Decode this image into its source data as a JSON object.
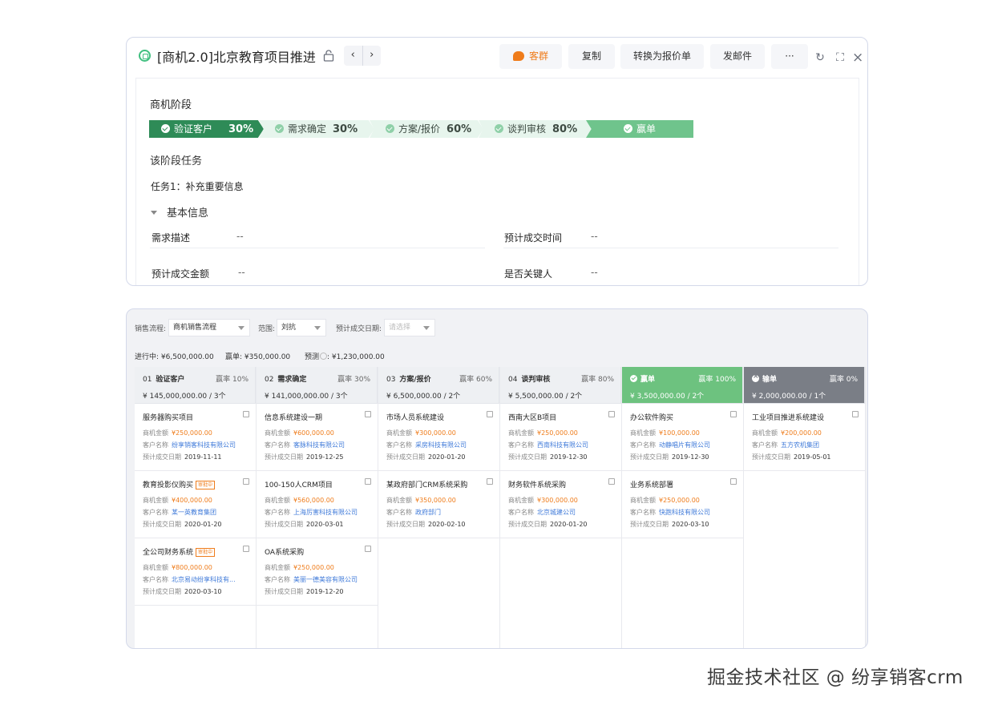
{
  "header": {
    "title": "[商机2.0]北京教育项目推进",
    "nav_prev": "‹",
    "nav_next": "›",
    "buttons": {
      "group": "客群",
      "copy": "复制",
      "convert": "转换为报价单",
      "email": "发邮件",
      "more": "···"
    },
    "icons": {
      "refresh": "↻",
      "expand": "⛶",
      "close": "×"
    }
  },
  "stage_section": {
    "title": "商机阶段",
    "stages": [
      {
        "label": "验证客户",
        "pct": "30%"
      },
      {
        "label": "需求确定",
        "pct": "30%"
      },
      {
        "label": "方案/报价",
        "pct": "60%"
      },
      {
        "label": "谈判审核",
        "pct": "80%"
      },
      {
        "label": "赢单",
        "pct": ""
      }
    ]
  },
  "task_section": {
    "title": "该阶段任务",
    "task": "任务1：补充重要信息",
    "basic_info": "基本信息",
    "fields": [
      {
        "label": "需求描述",
        "value": "--"
      },
      {
        "label": "预计成交时间",
        "value": "--"
      },
      {
        "label": "预计成交金额",
        "value": "--"
      },
      {
        "label": "是否关键人",
        "value": "--"
      }
    ]
  },
  "filters": {
    "process_label": "销售流程:",
    "process_value": "商机销售流程",
    "scope_label": "范围:",
    "scope_value": "刘抗",
    "date_label": "预计成交日期:",
    "date_placeholder": "请选择"
  },
  "summary": {
    "ongoing": "进行中: ¥6,500,000.00",
    "won": "赢单: ¥350,000.00",
    "forecast_label": "预测",
    "forecast_value": ": ¥1,230,000.00"
  },
  "columns": [
    {
      "num": "01",
      "name": "验证客户",
      "rate": "赢率 10%",
      "amount": "¥ 145,000,000.00 / 3个",
      "cards": [
        {
          "title": "服务器购买项目",
          "tag": "",
          "amount": "¥250,000.00",
          "customer": "纷享销客科技有限公司",
          "date": "2019-11-11"
        },
        {
          "title": "教育投影仪购买",
          "tag": "审批中",
          "amount": "¥400,000.00",
          "customer": "某一英教育集团",
          "date": "2020-01-20"
        },
        {
          "title": "全公司财务系统",
          "tag": "审批中",
          "amount": "¥800,000.00",
          "customer": "北京易动纷享科技有...",
          "date": "2020-03-10"
        }
      ]
    },
    {
      "num": "02",
      "name": "需求确定",
      "rate": "赢率 30%",
      "amount": "¥ 141,000,000.00 / 3个",
      "cards": [
        {
          "title": "信息系统建设一期",
          "tag": "",
          "amount": "¥600,000.00",
          "customer": "客脉科技有限公司",
          "date": "2019-12-25"
        },
        {
          "title": "100-150人CRM项目",
          "tag": "",
          "amount": "¥560,000.00",
          "customer": "上海厉害科技有限公司",
          "date": "2020-03-01"
        },
        {
          "title": "OA系统采购",
          "tag": "",
          "amount": "¥250,000.00",
          "customer": "美丽一德美容有限公司",
          "date": "2019-12-20"
        }
      ]
    },
    {
      "num": "03",
      "name": "方案/报价",
      "rate": "赢率 60%",
      "amount": "¥ 6,500,000.00 / 2个",
      "cards": [
        {
          "title": "市场人员系统建设",
          "tag": "",
          "amount": "¥300,000.00",
          "customer": "采房科技有限公司",
          "date": "2020-01-20"
        },
        {
          "title": "某政府部门CRM系统采购",
          "tag": "",
          "amount": "¥350,000.00",
          "customer": "政府部门",
          "date": "2020-02-10"
        }
      ]
    },
    {
      "num": "04",
      "name": "谈判审核",
      "rate": "赢率 80%",
      "amount": "¥ 5,500,000.00 / 2个",
      "cards": [
        {
          "title": "西南大区B项目",
          "tag": "",
          "amount": "¥250,000.00",
          "customer": "西南科技有限公司",
          "date": "2019-12-30"
        },
        {
          "title": "财务软件系统采购",
          "tag": "",
          "amount": "¥300,000.00",
          "customer": "北京城建公司",
          "date": "2020-01-20"
        }
      ]
    },
    {
      "num": "",
      "name": "赢单",
      "rate": "赢率 100%",
      "amount": "¥ 3,500,000.00 / 2个",
      "cards": [
        {
          "title": "办公软件购买",
          "tag": "",
          "amount": "¥100,000.00",
          "customer": "动静唱片有限公司",
          "date": "2019-12-30"
        },
        {
          "title": "业务系统部署",
          "tag": "",
          "amount": "¥250,000.00",
          "customer": "快跑科技有限公司",
          "date": "2020-03-10"
        }
      ]
    },
    {
      "num": "",
      "name": "输单",
      "rate": "赢率 0%",
      "amount": "¥ 2,000,000.00 / 1个",
      "cards": [
        {
          "title": "工业项目推进系统建设",
          "tag": "",
          "amount": "¥200,000.00",
          "customer": "五方农机集团",
          "date": "2019-05-01"
        }
      ]
    }
  ],
  "card_labels": {
    "amount": "商机金额",
    "customer": "客户名称",
    "date": "预计成交日期"
  },
  "watermark": "掘金技术社区 @ 纷享销客crm",
  "colors": {
    "primary_green": "#2e8b57",
    "light_green": "#e7f5ed",
    "win_green": "#6dc27f",
    "lose_gray": "#7a7e86",
    "accent_orange": "#ef7c1b",
    "link_blue": "#3f7ad9"
  }
}
